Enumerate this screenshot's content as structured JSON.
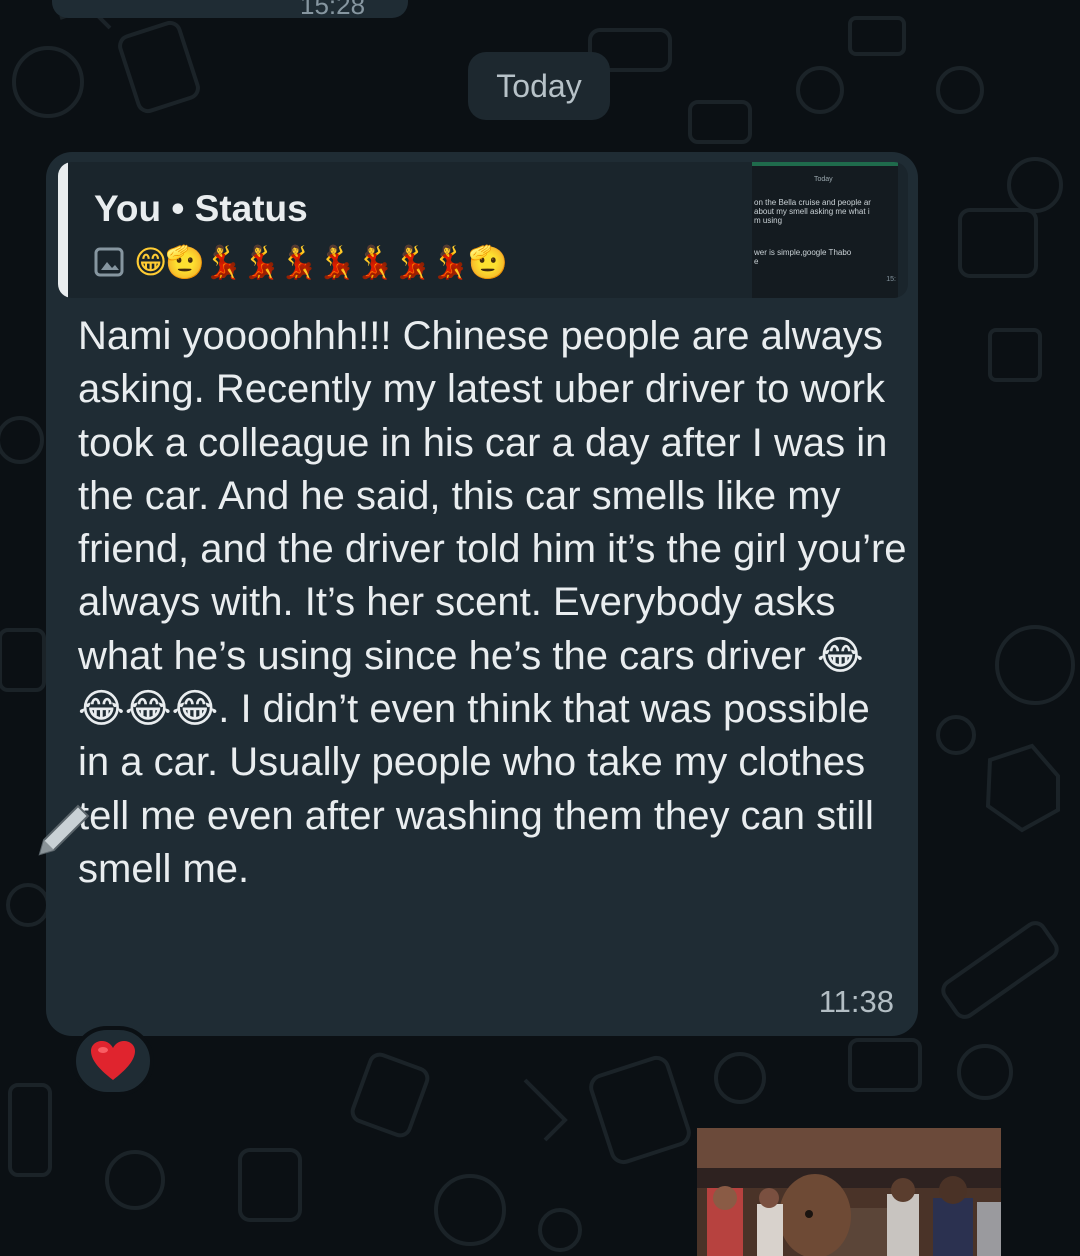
{
  "top": {
    "time_label": "15:28"
  },
  "date_chip": {
    "label": "Today"
  },
  "message": {
    "reply": {
      "title": "You • Status",
      "emoji_line": "😁🫡💃💃💃💃💃💃💃🫡",
      "thumbnail": {
        "date": "Today",
        "text1": "on the Bella cruise and people ar\nabout my smell asking me what i\nm using",
        "text2": "wer is simple,google Thabo\ne",
        "time": "15:"
      }
    },
    "text": "Nami yoooohhh!!! Chinese people are always asking. Recently my latest uber driver to work took a colleague in his car a day after I was in the car. And he said, this car smells like my friend, and the driver told him it’s the girl you’re always with. It’s her scent. Everybody asks what he’s using since he’s the cars driver 😂😂😂😂. I didn’t even think that was possible in a car. Usually people who take my clothes tell me even after washing them they can still smell me.",
    "time": "11:38"
  },
  "reaction": {
    "emoji": "❤️"
  },
  "colors": {
    "background": "#0b1014",
    "bubble": "#1f2c34",
    "text": "#e9edef",
    "meta": "#8696a0"
  },
  "icons": [
    "image-icon",
    "pencil-icon",
    "heart-reaction-icon"
  ]
}
